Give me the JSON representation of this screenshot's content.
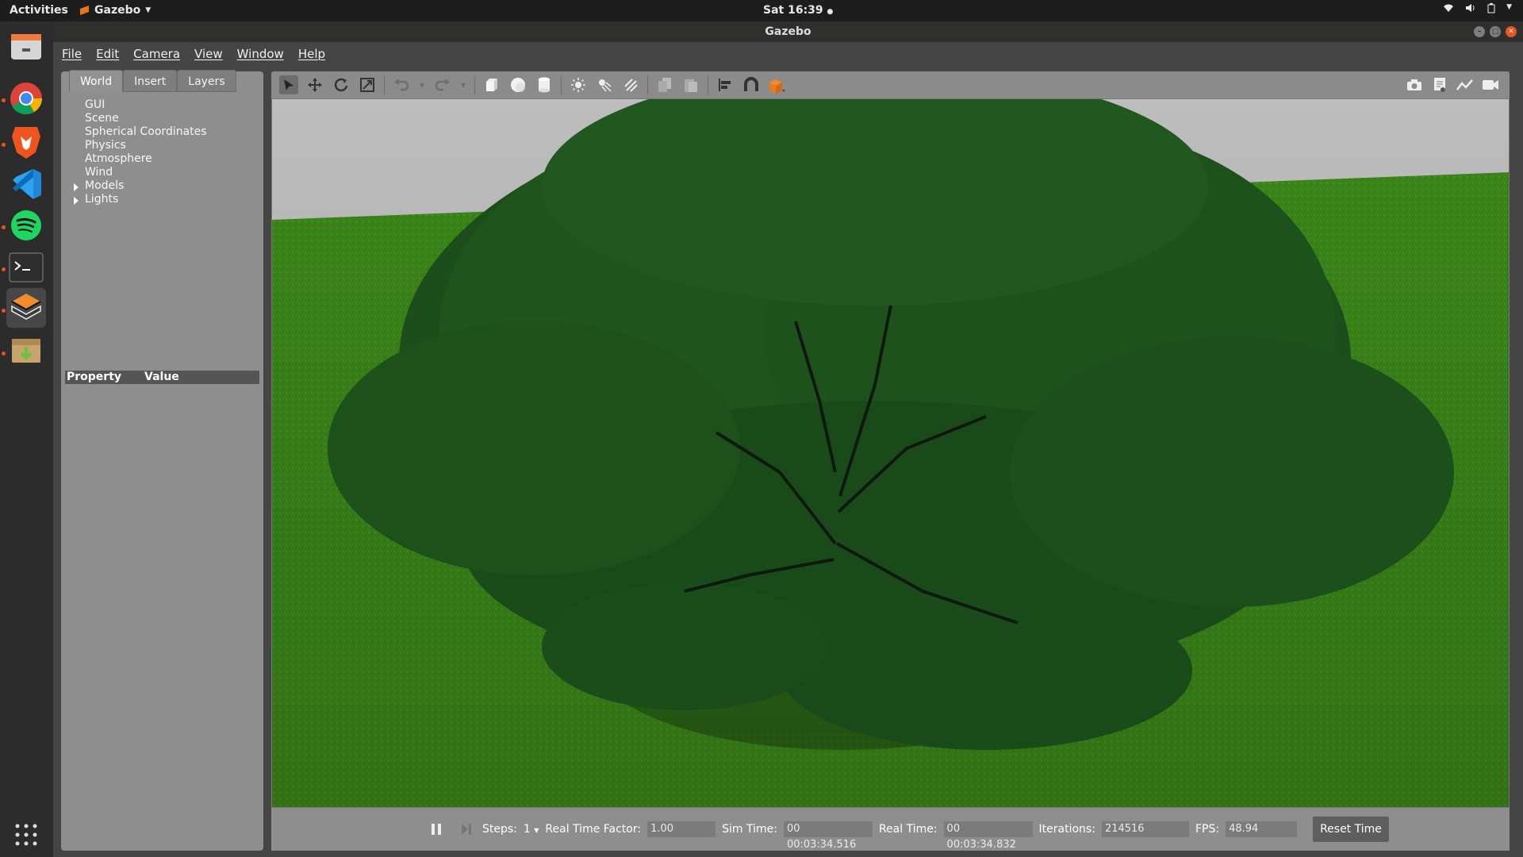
{
  "topbar": {
    "activities": "Activities",
    "app_name": "Gazebo",
    "clock": "Sat 16:39"
  },
  "window": {
    "title": "Gazebo"
  },
  "menubar": {
    "items": [
      "File",
      "Edit",
      "Camera",
      "View",
      "Window",
      "Help"
    ]
  },
  "left_panel": {
    "tabs": [
      "World",
      "Insert",
      "Layers"
    ],
    "selected_tab": "World",
    "tree": [
      "GUI",
      "Scene",
      "Spherical Coordinates",
      "Physics",
      "Atmosphere",
      "Wind",
      "Models",
      "Lights"
    ],
    "property_header": {
      "property": "Property",
      "value": "Value"
    }
  },
  "bottom_bar": {
    "steps_label": "Steps:",
    "steps_value": "1",
    "rtf_label": "Real Time Factor:",
    "rtf_value": "1.00",
    "sim_time_label": "Sim Time:",
    "sim_time_value": "00 00:03:34.516",
    "real_time_label": "Real Time:",
    "real_time_value": "00 00:03:34.832",
    "iterations_label": "Iterations:",
    "iterations_value": "214516",
    "fps_label": "FPS:",
    "fps_value": "48.94",
    "reset_label": "Reset Time"
  },
  "colors": {
    "grass": "#3d8a1d",
    "sky": "#bcbcbc",
    "foliage": "#1d4f1c",
    "accent": "#e95420"
  },
  "dock_icons": [
    "files-icon",
    "chrome-icon",
    "brave-icon",
    "vscode-icon",
    "spotify-icon",
    "terminal-icon",
    "gazebo-icon",
    "software-install-icon",
    "app-grid-icon"
  ]
}
